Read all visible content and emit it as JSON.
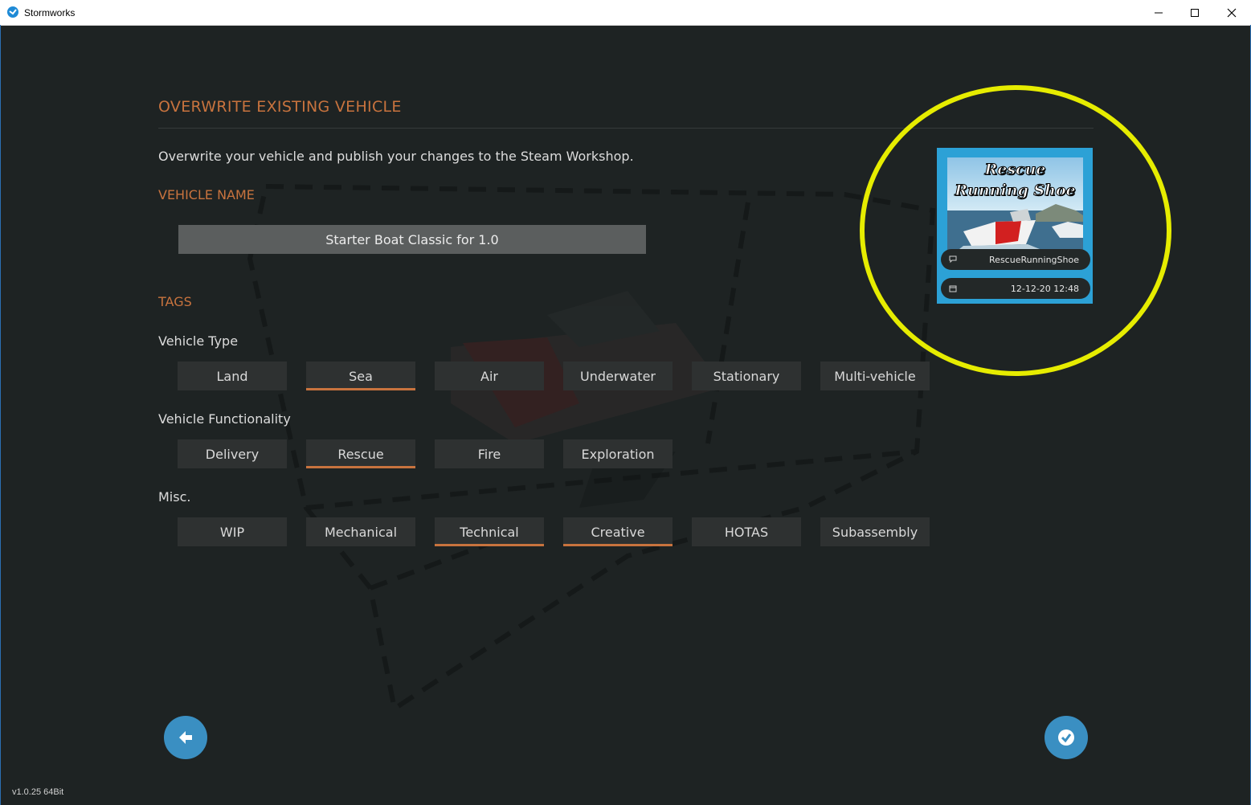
{
  "window": {
    "title": "Stormworks"
  },
  "page": {
    "heading": "OVERWRITE EXISTING VEHICLE",
    "description": "Overwrite your vehicle and publish your changes to the Steam Workshop.",
    "vehicle_name_label": "VEHICLE NAME",
    "vehicle_name_value": "Starter Boat Classic for 1.0",
    "tags_label": "TAGS"
  },
  "tag_groups": {
    "vehicle_type": {
      "label": "Vehicle Type",
      "tags": [
        {
          "label": "Land",
          "selected": false
        },
        {
          "label": "Sea",
          "selected": true
        },
        {
          "label": "Air",
          "selected": false
        },
        {
          "label": "Underwater",
          "selected": false
        },
        {
          "label": "Stationary",
          "selected": false
        },
        {
          "label": "Multi-vehicle",
          "selected": false
        }
      ]
    },
    "vehicle_functionality": {
      "label": "Vehicle Functionality",
      "tags": [
        {
          "label": "Delivery",
          "selected": false
        },
        {
          "label": "Rescue",
          "selected": true
        },
        {
          "label": "Fire",
          "selected": false
        },
        {
          "label": "Exploration",
          "selected": false
        }
      ]
    },
    "misc": {
      "label": "Misc.",
      "tags": [
        {
          "label": "WIP",
          "selected": false
        },
        {
          "label": "Mechanical",
          "selected": false
        },
        {
          "label": "Technical",
          "selected": true
        },
        {
          "label": "Creative",
          "selected": true
        },
        {
          "label": "HOTAS",
          "selected": false
        },
        {
          "label": "Subassembly",
          "selected": false
        }
      ]
    }
  },
  "thumbnail": {
    "image_title_line1": "Rescue",
    "image_title_line2": "Running Shoe",
    "author": "RescueRunningShoe",
    "date": "12-12-20 12:48",
    "author_icon": "comment-icon",
    "date_icon": "calendar-icon"
  },
  "footer": {
    "back_icon": "arrow-left-icon",
    "confirm_icon": "checkmark-icon",
    "version": "v1.0.25 64Bit"
  },
  "colors": {
    "accent": "#c8733e",
    "button_blue": "#3a8fc2",
    "highlight": "#e6ec00",
    "background": "#1e2323"
  }
}
